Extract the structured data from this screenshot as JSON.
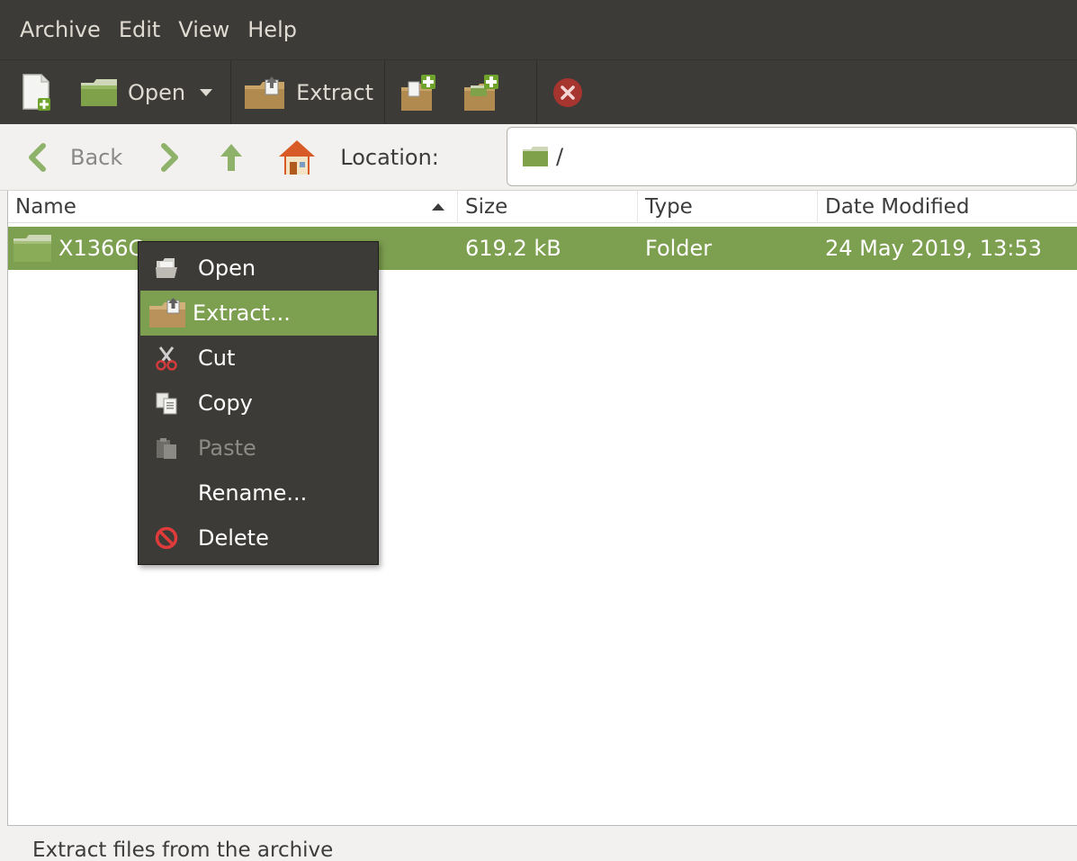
{
  "menubar": {
    "items": [
      "Archive",
      "Edit",
      "View",
      "Help"
    ]
  },
  "toolbar": {
    "open_label": "Open",
    "extract_label": "Extract"
  },
  "navbar": {
    "back_label": "Back",
    "location_label": "Location:",
    "location_value": "/"
  },
  "filelist": {
    "columns": [
      "Name",
      "Size",
      "Type",
      "Date Modified"
    ],
    "rows": [
      {
        "name": "X1366C",
        "size": "619.2 kB",
        "type": "Folder",
        "date": "24 May 2019, 13:53"
      }
    ]
  },
  "context_menu": {
    "items": [
      {
        "label": "Open",
        "icon": "open-folder-icon",
        "state": "normal"
      },
      {
        "label": "Extract...",
        "icon": "extract-icon",
        "state": "active"
      },
      {
        "label": "Cut",
        "icon": "scissors-icon",
        "state": "normal"
      },
      {
        "label": "Copy",
        "icon": "copy-icon",
        "state": "normal"
      },
      {
        "label": "Paste",
        "icon": "paste-icon",
        "state": "disabled"
      },
      {
        "label": "Rename...",
        "icon": "",
        "state": "normal"
      },
      {
        "label": "Delete",
        "icon": "delete-icon",
        "state": "normal"
      }
    ]
  },
  "statusbar": {
    "text": "Extract files from the archive"
  },
  "colors": {
    "selection": "#7d9f50",
    "toolbar_bg": "#3c3b37"
  }
}
